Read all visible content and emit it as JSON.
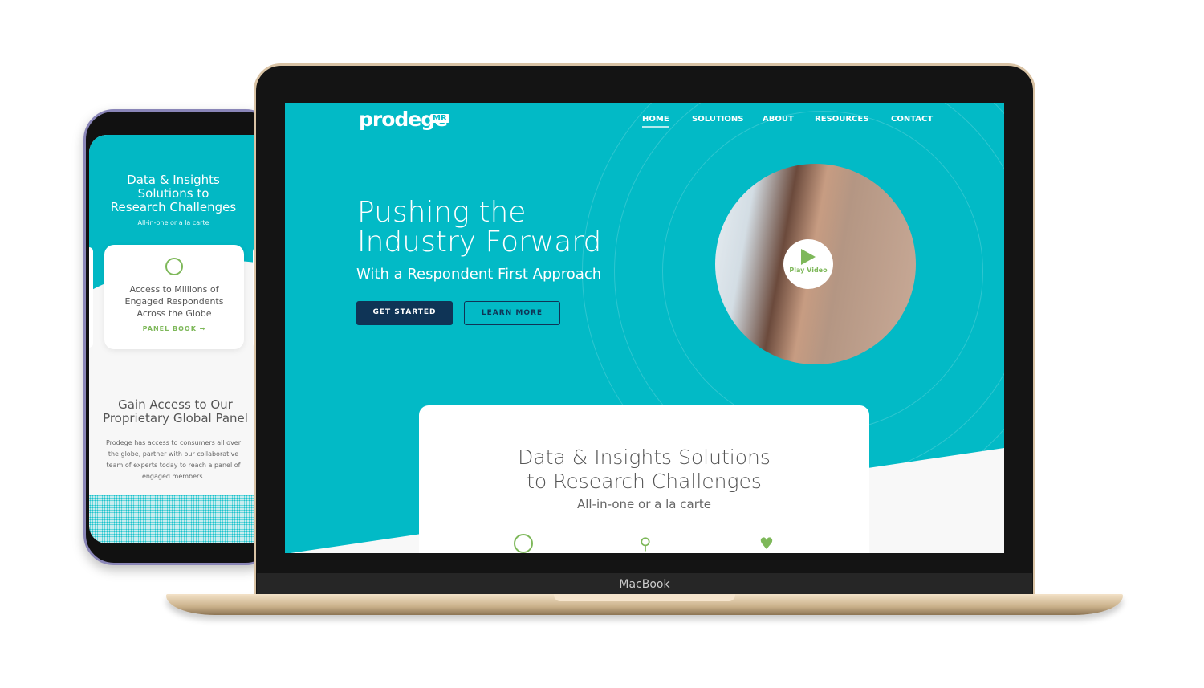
{
  "device_label": "MacBook",
  "desktop": {
    "logo": "prodege",
    "logo_badge": "MR",
    "nav": [
      "HOME",
      "SOLUTIONS",
      "ABOUT",
      "RESOURCES",
      "CONTACT"
    ],
    "hero_title_1": "Pushing the",
    "hero_title_2": "Industry Forward",
    "hero_subtitle": "With a Respondent First Approach",
    "get_started": "GET STARTED",
    "learn_more": "LEARN MORE",
    "play_video": "Play Video",
    "card_title_1": "Data & Insights Solutions",
    "card_title_2": "to Research Challenges",
    "card_subtitle": "All-in-one or a la carte",
    "icons": [
      "globe-icon",
      "magnifier-icon",
      "handshake-icon"
    ],
    "colors": {
      "teal": "#02bac6",
      "navy": "#0f3456",
      "green": "#7eb85a"
    }
  },
  "mobile": {
    "title_1": "Data & Insights",
    "title_2": "Solutions to",
    "title_3": "Research Challenges",
    "subtitle": "All-in-one or a la carte",
    "card_text_1": "Access to Millions of",
    "card_text_2": "Engaged Respondents",
    "card_text_3": "Across the Globe",
    "card_link": "PANEL BOOK →",
    "section_title_1": "Gain Access to Our",
    "section_title_2": "Proprietary Global Panel",
    "section_text": "Prodege has access to consumers all over the globe, partner with our collaborative team of experts today to reach a panel of engaged members."
  }
}
